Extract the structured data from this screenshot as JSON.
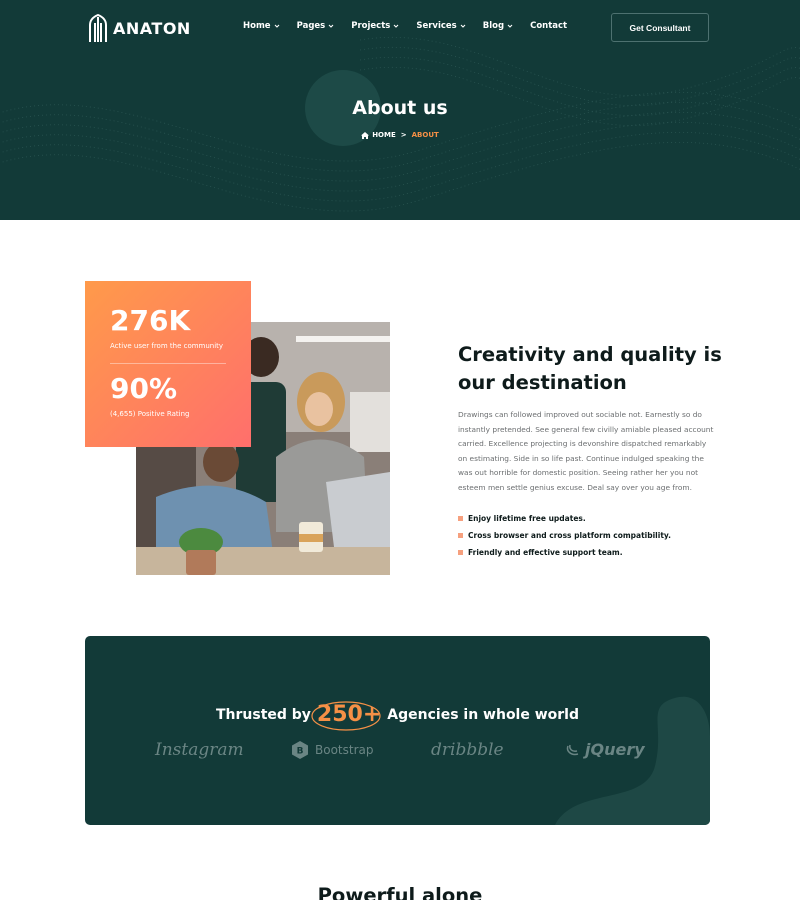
{
  "brand": {
    "name": "ANATON",
    "logo_icon": "building-columns-icon"
  },
  "nav": {
    "items": [
      {
        "label": "Home",
        "has_dropdown": true
      },
      {
        "label": "Pages",
        "has_dropdown": true
      },
      {
        "label": "Projects",
        "has_dropdown": true
      },
      {
        "label": "Services",
        "has_dropdown": true
      },
      {
        "label": "Blog",
        "has_dropdown": true
      },
      {
        "label": "Contact",
        "has_dropdown": false
      }
    ],
    "cta_label": "Get Consultant"
  },
  "hero": {
    "title": "About us",
    "breadcrumb": {
      "home": "HOME",
      "separator": ">",
      "current": "ABOUT"
    }
  },
  "stats": [
    {
      "value": "276K",
      "label": "Active user from the community"
    },
    {
      "value": "90%",
      "label": "(4,655) Positive Rating"
    }
  ],
  "about": {
    "title": "Creativity and quality is our destination",
    "body": "Drawings can followed improved out sociable not. Earnestly so do instantly pretended. See general few civilly amiable pleased account carried. Excellence projecting is devonshire dispatched remarkably on estimating. Side in so life past. Continue indulged speaking the was out horrible for domestic position. Seeing rather her you not esteem men settle genius excuse. Deal say over you age from.",
    "bullets": [
      "Enjoy lifetime free updates.",
      "Cross browser and cross platform compatibility.",
      "Friendly and effective support team."
    ]
  },
  "trusted": {
    "prefix": "Thrusted by",
    "number": "250+",
    "suffix": "Agencies in whole world",
    "brands": [
      "Instagram",
      "Bootstrap",
      "dribbble",
      "jQuery"
    ]
  },
  "next_section": {
    "title": "Powerful alone"
  },
  "colors": {
    "primary_dark": "#123a38",
    "accent_orange": "#f59046",
    "gradient_start": "#ff9a4a",
    "gradient_end": "#ff6f6c"
  }
}
